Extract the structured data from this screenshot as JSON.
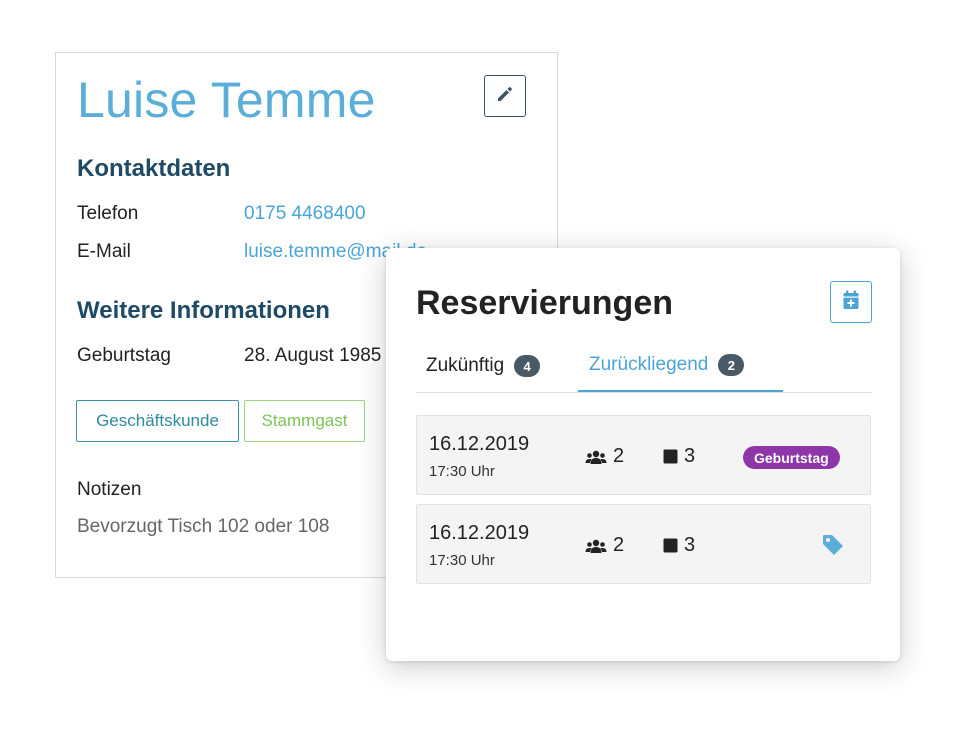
{
  "customer": {
    "name": "Luise Temme",
    "contact_heading": "Kontaktdaten",
    "phone_label": "Telefon",
    "phone_value": "0175 4468400",
    "email_label": "E-Mail",
    "email_value": "luise.temme@mail.de",
    "more_heading": "Weitere Informationen",
    "birthday_label": "Geburtstag",
    "birthday_value": "28. August 1985",
    "tags": [
      "Geschäftskunde",
      "Stammgast"
    ],
    "notes_label": "Notizen",
    "notes_value": "Bevorzugt Tisch 102 oder 108",
    "edit_icon": "pencil-icon"
  },
  "reservations": {
    "title": "Reservierungen",
    "add_icon": "calendar-plus-icon",
    "tabs": [
      {
        "label": "Zukünftig",
        "count": "4",
        "active": false
      },
      {
        "label": "Zurückliegend",
        "count": "2",
        "active": true
      }
    ],
    "items": [
      {
        "date": "16.12.2019",
        "time": "17:30 Uhr",
        "guests": "2",
        "table": "3",
        "occasion": "Geburtstag"
      },
      {
        "date": "16.12.2019",
        "time": "17:30 Uhr",
        "guests": "2",
        "table": "3",
        "occasion": ""
      }
    ]
  },
  "colors": {
    "accent": "#4aa5d6",
    "heading": "#1e4a66",
    "occasion_badge": "#8e35a7",
    "count_badge": "#475a66",
    "tag_business": "#3e93a7",
    "tag_regular": "#7cc453"
  }
}
